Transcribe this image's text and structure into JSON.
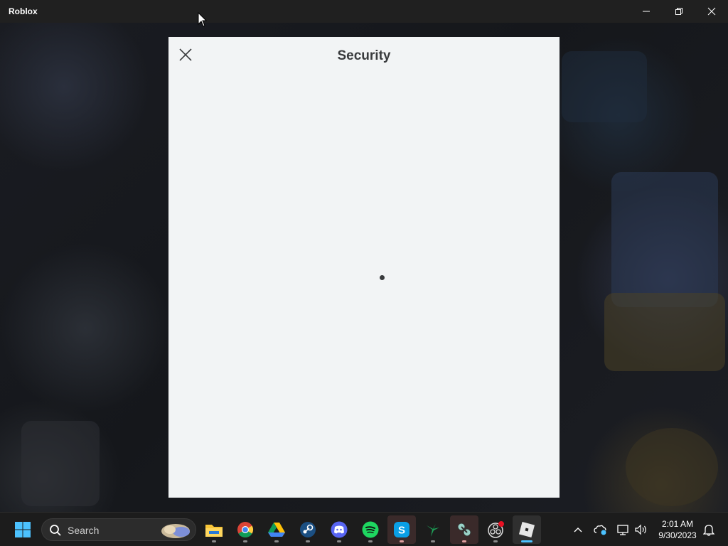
{
  "window": {
    "title": "Roblox",
    "controls": {
      "minimize": "minimize-icon",
      "restore": "restore-icon",
      "close": "close-icon"
    }
  },
  "modal": {
    "title": "Security",
    "close_icon": "close-icon",
    "loading": true
  },
  "taskbar": {
    "search": {
      "label": "Search"
    },
    "apps": [
      "windows-start",
      "file-explorer",
      "google-chrome",
      "google-drive",
      "steam",
      "discord",
      "spotify",
      "skype",
      "hummingbird-app",
      "mixer-app",
      "obs-studio",
      "roblox"
    ],
    "tray": {
      "time": "2:01 AM",
      "date": "9/30/2023"
    }
  },
  "colors": {
    "titlebar": "#202020",
    "modal_bg": "#f2f4f5",
    "modal_text": "#393b3d",
    "taskbar": "#1c1c1c",
    "accent": "#4cc2ff"
  }
}
